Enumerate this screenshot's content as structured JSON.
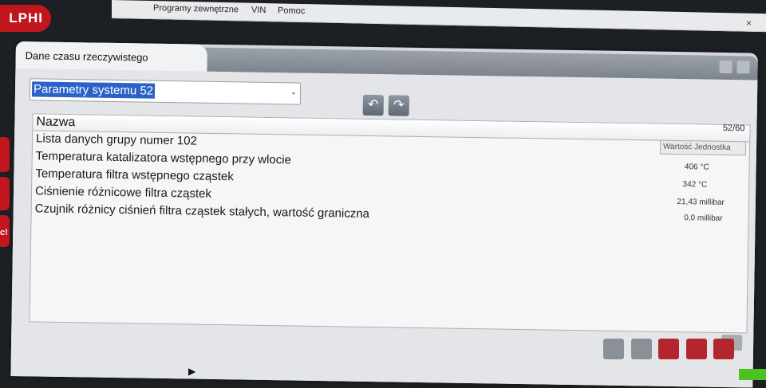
{
  "menu": {
    "items": [
      "Programy zewnętrzne",
      "VIN",
      "Pomoc"
    ]
  },
  "window": {
    "close_label": "×"
  },
  "logo": {
    "text": "LPHI"
  },
  "sidebar": {
    "tab3_label": "c!"
  },
  "panel": {
    "title": "Dane czasu rzeczywistego"
  },
  "dropdown": {
    "selected": "Parametry systemu 52",
    "arrow": "⌄"
  },
  "nav": {
    "prev": "↶",
    "next": "↷"
  },
  "table": {
    "header_name": "Nazwa",
    "page_count": "52/60",
    "value_header": "Wartość Jednostka",
    "rows": [
      {
        "name": "Lista danych grupy numer 102",
        "value": ""
      },
      {
        "name": "Temperatura katalizatora wstępnego przy wlocie",
        "value": "406 °C"
      },
      {
        "name": "Temperatura filtra wstępnego cząstek",
        "value": "342 °C"
      },
      {
        "name": "Ciśnienie różnicowe filtra cząstek",
        "value": "21,43 millibar"
      },
      {
        "name": "Czujnik różnicy ciśnień filtra cząstek stałych, wartość graniczna",
        "value": "0,0 millibar"
      }
    ]
  },
  "colors": {
    "brand": "#c0161e",
    "selection": "#2a62c9",
    "panel": "#d4d6d9"
  }
}
